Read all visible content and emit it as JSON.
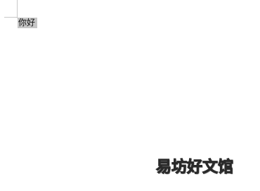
{
  "document": {
    "selected_text": "你好"
  },
  "watermark": {
    "text": "易坊好文馆"
  },
  "colors": {
    "page_background": "#ffffff",
    "selection_highlight": "#c6c6c6",
    "corner_marks": "#c8c8c8"
  }
}
